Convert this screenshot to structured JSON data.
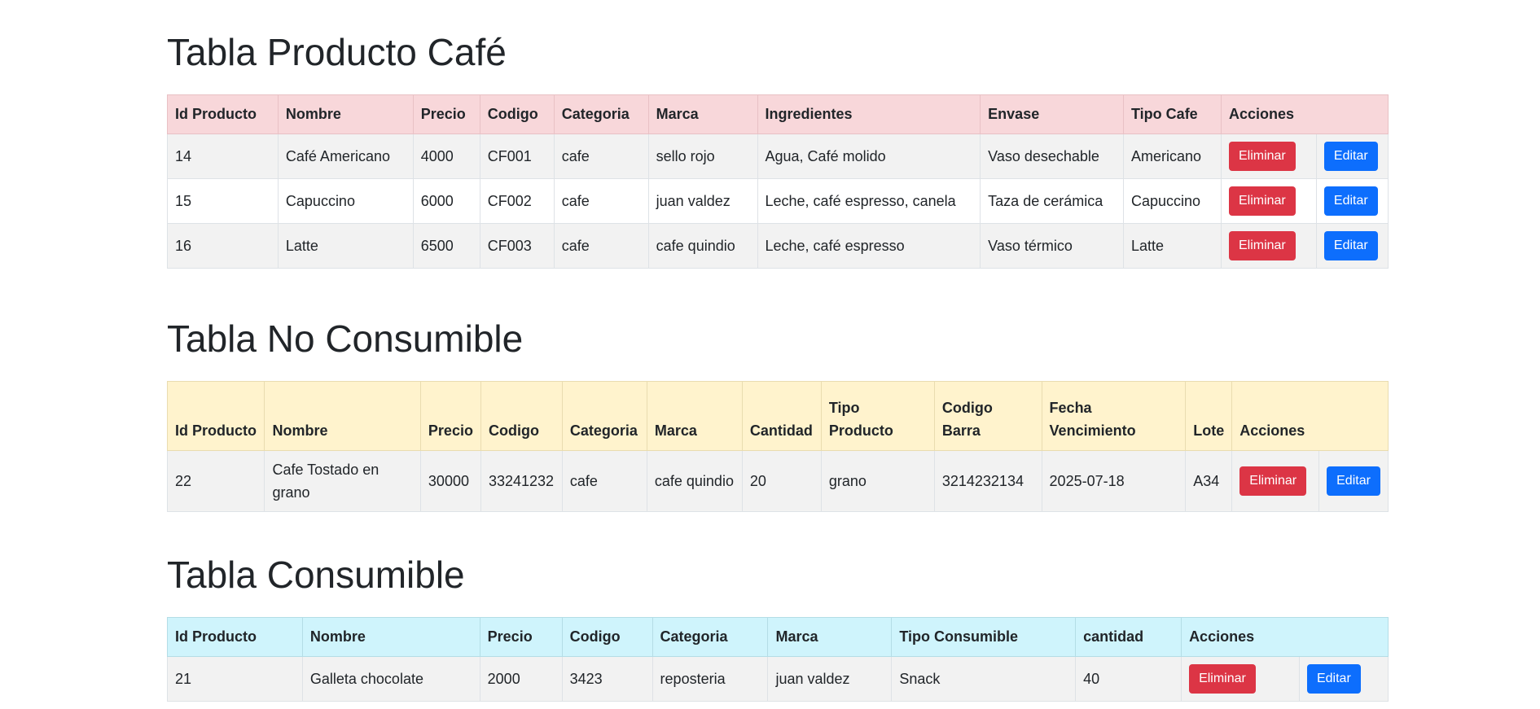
{
  "cafe": {
    "title": "Tabla Producto Café",
    "headers": [
      "Id Producto",
      "Nombre",
      "Precio",
      "Codigo",
      "Categoria",
      "Marca",
      "Ingredientes",
      "Envase",
      "Tipo Cafe",
      "Acciones"
    ],
    "rows": [
      [
        "14",
        "Café Americano",
        "4000",
        "CF001",
        "cafe",
        "sello rojo",
        "Agua, Café molido",
        "Vaso desechable",
        "Americano"
      ],
      [
        "15",
        "Capuccino",
        "6000",
        "CF002",
        "cafe",
        "juan valdez",
        "Leche, café espresso, canela",
        "Taza de cerámica",
        "Capuccino"
      ],
      [
        "16",
        "Latte",
        "6500",
        "CF003",
        "cafe",
        "cafe quindio",
        "Leche, café espresso",
        "Vaso térmico",
        "Latte"
      ]
    ]
  },
  "nocons": {
    "title": "Tabla No Consumible",
    "headers": [
      "Id Producto",
      "Nombre",
      "Precio",
      "Codigo",
      "Categoria",
      "Marca",
      "Cantidad",
      "Tipo Producto",
      "Codigo Barra",
      "Fecha Vencimiento",
      "Lote",
      "Acciones"
    ],
    "rows": [
      [
        "22",
        "Cafe Tostado en grano",
        "30000",
        "33241232",
        "cafe",
        "cafe quindio",
        "20",
        "grano",
        "3214232134",
        "2025-07-18",
        "A34"
      ]
    ]
  },
  "cons": {
    "title": "Tabla Consumible",
    "headers": [
      "Id Producto",
      "Nombre",
      "Precio",
      "Codigo",
      "Categoria",
      "Marca",
      "Tipo Consumible",
      "cantidad",
      "Acciones"
    ],
    "rows": [
      [
        "21",
        "Galleta chocolate",
        "2000",
        "3423",
        "reposteria",
        "juan valdez",
        "Snack",
        "40"
      ]
    ]
  },
  "buttons": {
    "delete": "Eliminar",
    "edit": "Editar"
  },
  "colors": {
    "danger": "#dc3545",
    "primary": "#0d6efd",
    "cafe_header": "#f8d7da",
    "nocons_header": "#fff3cd",
    "cons_header": "#cff4fc"
  }
}
